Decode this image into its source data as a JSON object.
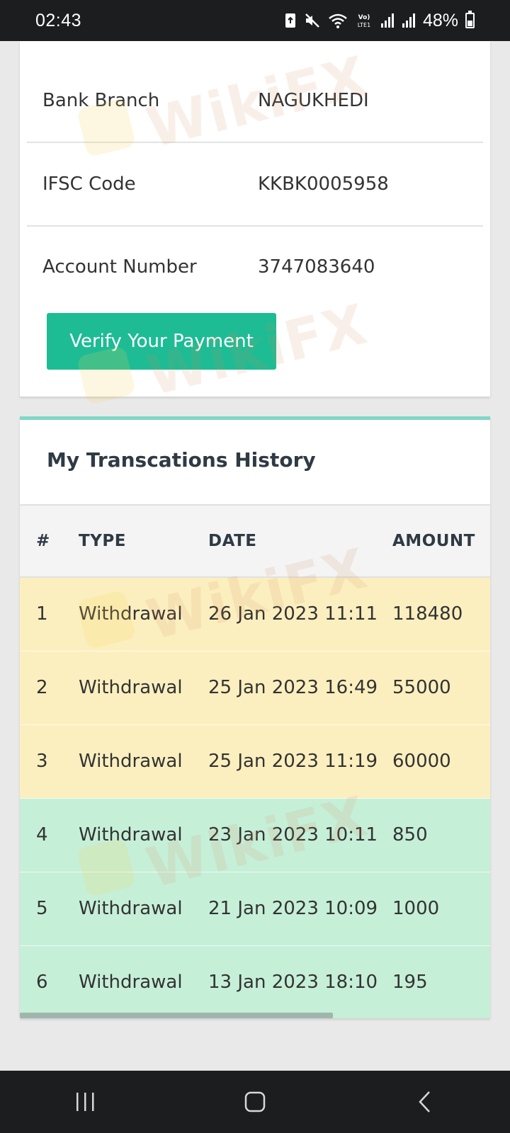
{
  "status_bar": {
    "time": "02:43",
    "battery": "48%",
    "network_label": "Vo) LTE1"
  },
  "bank_details": {
    "rows": [
      {
        "label": "Bank Branch",
        "value": "NAGUKHEDI"
      },
      {
        "label": "IFSC Code",
        "value": "KKBK0005958"
      },
      {
        "label": "Account Number",
        "value": "3747083640"
      }
    ],
    "verify_button": "Verify Your Payment"
  },
  "transactions": {
    "title": "My Transcations History",
    "columns": [
      "#",
      "TYPE",
      "DATE",
      "AMOUNT"
    ],
    "rows": [
      {
        "num": "1",
        "type": "Withdrawal",
        "date": "26 Jan 2023 11:11",
        "amount": "118480",
        "status": "pending"
      },
      {
        "num": "2",
        "type": "Withdrawal",
        "date": "25 Jan 2023 16:49",
        "amount": "55000",
        "status": "pending"
      },
      {
        "num": "3",
        "type": "Withdrawal",
        "date": "25 Jan 2023 11:19",
        "amount": "60000",
        "status": "pending"
      },
      {
        "num": "4",
        "type": "Withdrawal",
        "date": "23 Jan 2023 10:11",
        "amount": "850",
        "status": "completed"
      },
      {
        "num": "5",
        "type": "Withdrawal",
        "date": "21 Jan 2023 10:09",
        "amount": "1000",
        "status": "completed"
      },
      {
        "num": "6",
        "type": "Withdrawal",
        "date": "13 Jan 2023 18:10",
        "amount": "195",
        "status": "completed"
      }
    ]
  },
  "watermark": "WikiFX",
  "colors": {
    "accent": "#1dbc94",
    "pending_row": "#fcefbf",
    "completed_row": "#c6efd8",
    "card_top_border": "#7fd8c6"
  },
  "nav_icons": [
    "recent-apps-icon",
    "home-icon",
    "back-icon"
  ]
}
